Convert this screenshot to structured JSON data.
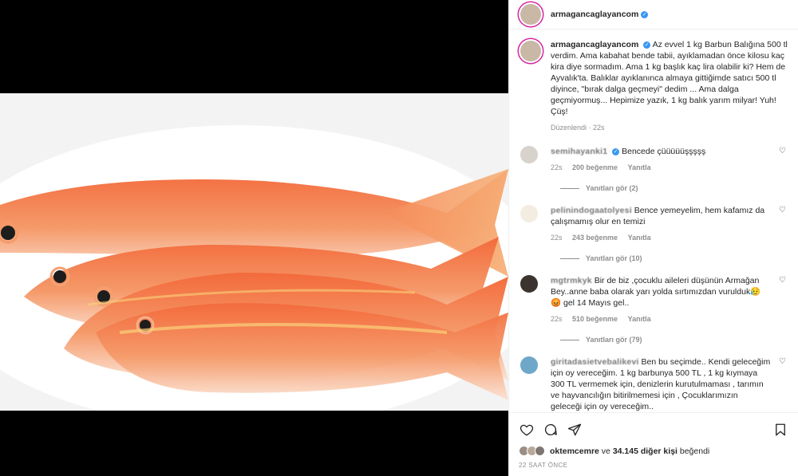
{
  "post": {
    "username": "armagancaglayancom",
    "verified_mark": "✓"
  },
  "caption": {
    "username": "armagancaglayancom",
    "text": "Az evvel 1 kg Barbun Balığına 500 tl verdim. Ama kabahat bende tabii, ayıklamadan önce kilosu kaç kira diye sormadım. Ama 1 kg başlık kaç lira olabilir ki? Hem de Ayvalık'ta. Balıklar ayıklanınca almaya gittiğimde satıcı 500 tl diyince, \"bırak dalga geçmeyi\" dedim ... Ama dalga geçmiyormuş... Hepimize yazık, 1 kg balık yarım milyar! Yuh! Çüş!",
    "edited": "Düzenlendi",
    "time": "22s"
  },
  "comments": [
    {
      "username": "semihayanki1",
      "verified": true,
      "text": "Bencede çüüüüüşşşşş",
      "time": "22s",
      "likes": "200 beğenme",
      "reply": "Yanıtla",
      "replies": "Yanıtları gör (2)"
    },
    {
      "username": "pelinindogaatolyesi",
      "verified": false,
      "text": "Bence yemeyelim, hem kafamız da çalışmamış olur en temizi",
      "time": "22s",
      "likes": "243 beğenme",
      "reply": "Yanıtla",
      "replies": "Yanıtları gör (10)"
    },
    {
      "username": "mgtrmkyk",
      "verified": false,
      "text": "Bir de biz ,çocuklu aileleri düşünün Armağan Bey..anne baba olarak yarı yolda sırtımızdan vurulduk😥😡 gel 14 Mayıs gel..",
      "time": "22s",
      "likes": "510 beğenme",
      "reply": "Yanıtla",
      "replies": "Yanıtları gör (79)"
    },
    {
      "username": "giritadasietvebalikevi",
      "verified": false,
      "text": "Ben bu seçimde.. Kendi geleceğim için oy vereceğim. 1 kg barbunya 500 TL , 1 kg kıymaya 300 TL vermemek için, denizlerin kurutulmaması , tarımın ve hayvancılığın bitirilmemesi için , Çocuklarımızın geleceği için oy vereceğim..",
      "time": "",
      "likes": "",
      "reply": "",
      "replies": ""
    }
  ],
  "likes": {
    "user": "oktemcemre",
    "connector": "ve",
    "others": "34.145 diğer kişi",
    "suffix": "beğendi"
  },
  "timeago": "22 SAAT ÖNCE",
  "icons": {
    "heart": "heart-icon",
    "comment": "comment-icon",
    "share": "share-icon",
    "save": "bookmark-icon"
  },
  "colors": {
    "verified": "#3897f0",
    "text": "#262626",
    "muted": "#8e8e8e",
    "fish": "#f08a5d"
  }
}
